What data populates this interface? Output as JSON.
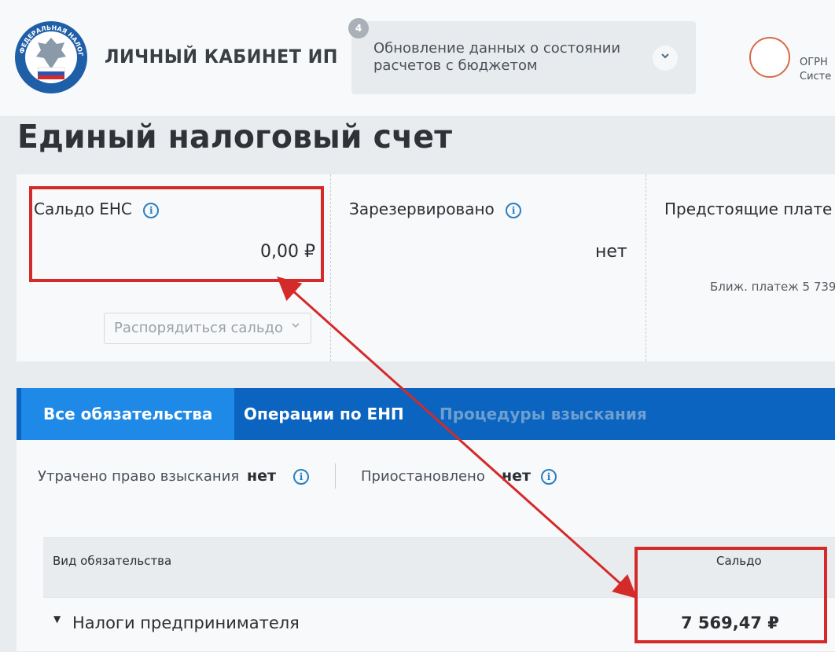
{
  "header": {
    "logo_text": "ФЕДЕРАЛЬНАЯ НАЛОГОВАЯ СЛУЖБА",
    "title": "ЛИЧНЫЙ КАБИНЕТ ИП",
    "notice": {
      "badge": "4",
      "text": "Обновление данных о состоянии расчетов с бюджетом",
      "icon": "chevron-down-icon"
    },
    "user": {
      "ogrn_label": "ОГРН",
      "system_label": "Систе"
    }
  },
  "page": {
    "title": "Единый налоговый счет"
  },
  "summary": {
    "saldo": {
      "label": "Сальдо ЕНС",
      "value": "0,00 ₽",
      "action_label": "Распорядиться сальдо",
      "action_icon": "chevron-down-icon"
    },
    "reserved": {
      "label": "Зарезервировано",
      "value": "нет"
    },
    "upcoming": {
      "label": "Предстоящие плате",
      "next_payment": "Ближ. платеж 5 739"
    },
    "info_icon": "i"
  },
  "tabs": [
    {
      "label": "Все обязательства",
      "state": "active"
    },
    {
      "label": "Операции по ЕНП",
      "state": "normal"
    },
    {
      "label": "Процедуры взыскания",
      "state": "disabled"
    }
  ],
  "filters": {
    "lost_right": {
      "label": "Утрачено право взыскания",
      "value": "нет"
    },
    "suspended": {
      "label": "Приостановлено",
      "value": "нет"
    }
  },
  "table": {
    "headers": {
      "type": "Вид обязательства",
      "saldo": "Сальдо"
    },
    "rows": [
      {
        "name": "Налоги предпринимателя",
        "amount": "7 569,47 ₽"
      }
    ]
  },
  "colors": {
    "tab_bar": "#0b64c0",
    "tab_active": "#1e89e6",
    "accent_blue": "#2a7fc0",
    "annotation_red": "#d42a2a"
  }
}
